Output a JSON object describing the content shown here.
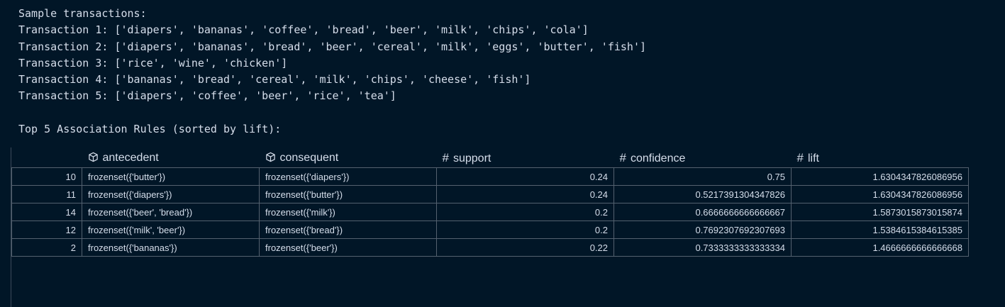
{
  "output": {
    "sample_heading": "Sample transactions:",
    "transactions": [
      "Transaction 1: ['diapers', 'bananas', 'coffee', 'bread', 'beer', 'milk', 'chips', 'cola']",
      "Transaction 2: ['diapers', 'bananas', 'bread', 'beer', 'cereal', 'milk', 'eggs', 'butter', 'fish']",
      "Transaction 3: ['rice', 'wine', 'chicken']",
      "Transaction 4: ['bananas', 'bread', 'cereal', 'milk', 'chips', 'cheese', 'fish']",
      "Transaction 5: ['diapers', 'coffee', 'beer', 'rice', 'tea']"
    ],
    "rules_heading": "Top 5 Association Rules (sorted by lift):"
  },
  "table": {
    "columns": [
      {
        "label": "antecedent",
        "icon": "object-cube-icon"
      },
      {
        "label": "consequent",
        "icon": "object-cube-icon"
      },
      {
        "label": "support",
        "icon": "hash-icon",
        "glyph": "#"
      },
      {
        "label": "confidence",
        "icon": "hash-icon",
        "glyph": "#"
      },
      {
        "label": "lift",
        "icon": "hash-icon",
        "glyph": "#"
      }
    ],
    "rows": [
      {
        "index": "10",
        "antecedent": "frozenset({'butter'})",
        "consequent": "frozenset({'diapers'})",
        "support": "0.24",
        "confidence": "0.75",
        "lift": "1.6304347826086956"
      },
      {
        "index": "11",
        "antecedent": "frozenset({'diapers'})",
        "consequent": "frozenset({'butter'})",
        "support": "0.24",
        "confidence": "0.5217391304347826",
        "lift": "1.6304347826086956"
      },
      {
        "index": "14",
        "antecedent": "frozenset({'beer', 'bread'})",
        "consequent": "frozenset({'milk'})",
        "support": "0.2",
        "confidence": "0.6666666666666667",
        "lift": "1.5873015873015874"
      },
      {
        "index": "12",
        "antecedent": "frozenset({'milk', 'beer'})",
        "consequent": "frozenset({'bread'})",
        "support": "0.2",
        "confidence": "0.7692307692307693",
        "lift": "1.5384615384615385"
      },
      {
        "index": "2",
        "antecedent": "frozenset({'bananas'})",
        "consequent": "frozenset({'beer'})",
        "support": "0.22",
        "confidence": "0.7333333333333334",
        "lift": "1.4666666666666668"
      }
    ]
  },
  "colors": {
    "background": "#011627",
    "text": "#d6deeb",
    "grid_border": "#54616f"
  }
}
